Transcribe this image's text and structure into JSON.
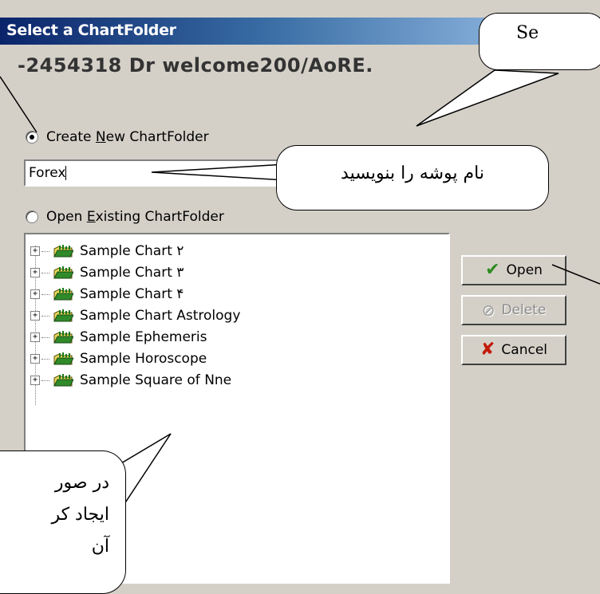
{
  "window": {
    "title": "Select a ChartFolder"
  },
  "registration": "-2454318 Dr welcome200/AoRE.",
  "create_option": {
    "prefix": "Create ",
    "mnemonic": "N",
    "suffix": "ew ChartFolder",
    "selected": true
  },
  "folder_name_input": {
    "value": "Forex"
  },
  "open_option": {
    "prefix": "Open ",
    "mnemonic": "E",
    "suffix": "xisting ChartFolder",
    "selected": false
  },
  "tree": {
    "items": [
      {
        "label": "Sample Chart ۲",
        "expander": "+"
      },
      {
        "label": "Sample Chart ۳",
        "expander": "+"
      },
      {
        "label": "Sample Chart ۴",
        "expander": "+"
      },
      {
        "label": "Sample Chart Astrology",
        "expander": "+"
      },
      {
        "label": "Sample Ephemeris",
        "expander": "+"
      },
      {
        "label": "Sample Horoscope",
        "expander": "+"
      },
      {
        "label": "Sample Square of Nne",
        "expander": "+"
      }
    ]
  },
  "buttons": {
    "open": {
      "label": "Open",
      "icon": "checkmark-icon",
      "color": "#2e8b22"
    },
    "delete": {
      "label": "Delete",
      "icon": "prohibited-icon",
      "enabled": false
    },
    "cancel": {
      "label": "Cancel",
      "icon": "x-icon",
      "color": "#c41a0a"
    }
  },
  "callouts": {
    "top_right": "Se",
    "name_hint": "نام پوشه را بنویسید",
    "bottom_left_line1": "در صور",
    "bottom_left_line2": "ایجاد کر",
    "bottom_left_line3": "آن"
  }
}
